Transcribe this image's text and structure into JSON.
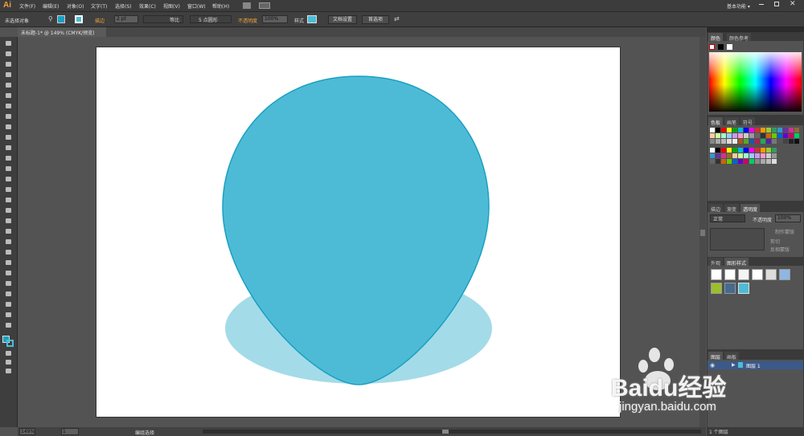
{
  "app": {
    "logo": "Ai",
    "workspace": "基本功能 ▾"
  },
  "menu": [
    "文件(F)",
    "编辑(E)",
    "对象(O)",
    "文字(T)",
    "选择(S)",
    "效果(C)",
    "视图(V)",
    "窗口(W)",
    "帮助(H)"
  ],
  "control": {
    "selection": "未选择对象",
    "stroke_label": "描边",
    "stroke_weight": "2 pt",
    "stroke_profile": "等比",
    "brush": "5 点圆形",
    "opacity_label": "不透明度",
    "opacity": "100%",
    "style_label": "样式",
    "doc_setup": "文档设置",
    "preferences": "首选项"
  },
  "document": {
    "tab": "未标题-1* @ 149% (CMYK/预览)"
  },
  "status": {
    "zoom": "149%",
    "artboard_num": "1",
    "mode": "编组选择"
  },
  "panels": {
    "color_tabs": [
      "颜色",
      "颜色参考"
    ],
    "swatch_tabs": [
      "色板",
      "画笔",
      "符号"
    ],
    "transparency_tabs": [
      "描边",
      "渐变",
      "透明度"
    ],
    "blend_mode": "正常",
    "opacity_label": "不透明度",
    "opacity_value": "100%",
    "make_mask": "制作蒙版",
    "clip": "剪切",
    "invert_mask": "反相蒙版",
    "style_tabs": [
      "外观",
      "图形样式"
    ],
    "layer_tabs": [
      "图层",
      "画板"
    ],
    "layer_name": "图层 1",
    "layer_count": "1 个图层"
  },
  "colors": {
    "fill": "#4ebbd6",
    "stroke": "#1aa0c2",
    "shadow": "#a4dbe8"
  },
  "watermark": {
    "brand": "Baidu经验",
    "url": "jingyan.baidu.com"
  }
}
